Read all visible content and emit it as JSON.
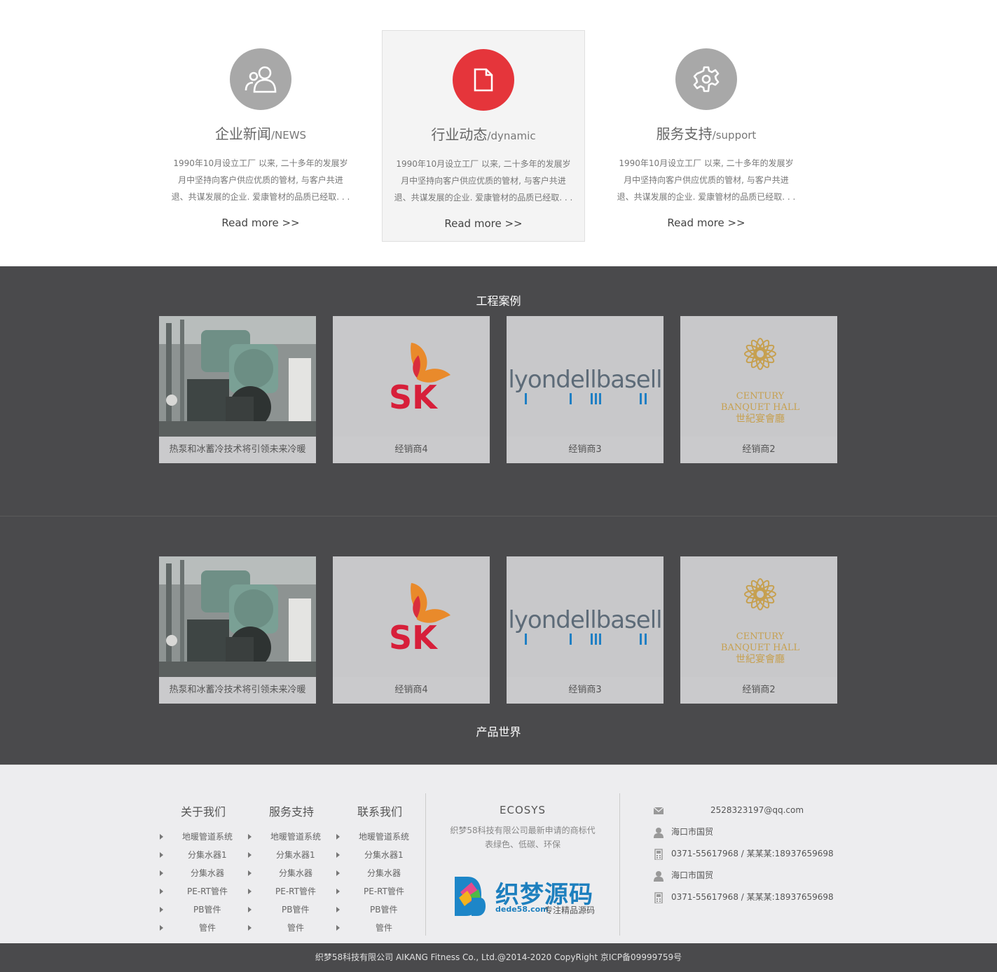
{
  "features": [
    {
      "title": "企业新闻",
      "sub": "/NEWS",
      "icon": "users-icon",
      "desc": "1990年10月设立工厂  以来, 二十多年的发展岁月中坚持向客户供应优质的管材, 与客户共进退、共谋发展的企业. 爱康管材的品质已经取. . .",
      "more": "Read more >>"
    },
    {
      "title": "行业动态",
      "sub": "/dynamic",
      "icon": "document-icon",
      "desc": "1990年10月设立工厂  以来, 二十多年的发展岁月中坚持向客户供应优质的管材, 与客户共进退、共谋发展的企业. 爱康管材的品质已经取. . .",
      "more": "Read more >>"
    },
    {
      "title": "服务支持",
      "sub": "/support",
      "icon": "gear-icon",
      "desc": "1990年10月设立工厂  以来, 二十多年的发展岁月中坚持向客户供应优质的管材, 与客户共进退、共谋发展的企业. 爱康管材的品质已经取. . .",
      "more": "Read more >>"
    }
  ],
  "cases": {
    "title": "工程案例",
    "items": [
      {
        "label": "热泵和冰蓄冷技术将引领未来冷暖"
      },
      {
        "label": "经销商4",
        "logo_text": "SK"
      },
      {
        "label": "经销商3",
        "logo_text": "lyondellbasell"
      },
      {
        "label": "经销商2",
        "logo_text": [
          "CENTURY",
          "BANQUET HALL",
          "世紀宴會廳"
        ]
      }
    ]
  },
  "products": {
    "title": "产品世界",
    "items": [
      {
        "label": "热泵和冰蓄冷技术将引领未来冷暖"
      },
      {
        "label": "经销商4",
        "logo_text": "SK"
      },
      {
        "label": "经销商3",
        "logo_text": "lyondellbasell"
      },
      {
        "label": "经销商2",
        "logo_text": [
          "CENTURY",
          "BANQUET HALL",
          "世紀宴會廳"
        ]
      }
    ]
  },
  "footer": {
    "columns": [
      {
        "head": "关于我们",
        "links": [
          "地暖管道系统",
          "分集水器1",
          "分集水器",
          "PE-RT管件",
          "PB管件",
          "管件"
        ]
      },
      {
        "head": "服务支持",
        "links": [
          "地暖管道系统",
          "分集水器1",
          "分集水器",
          "PE-RT管件",
          "PB管件",
          "管件"
        ]
      },
      {
        "head": "联系我们",
        "links": [
          "地暖管道系统",
          "分集水器1",
          "分集水器",
          "PE-RT管件",
          "PB管件",
          "管件"
        ]
      }
    ],
    "brand": {
      "head": "ECOSYS",
      "line1": "织梦58科技有限公司最新申请的商标代",
      "line2": "表绿色、低碳、环保",
      "logo_main": "织梦源码",
      "logo_domain": "dede58.com",
      "logo_tag": "专注精品源码"
    },
    "contact": [
      {
        "icon": "mail-icon",
        "text": "2528323197@qq.com"
      },
      {
        "icon": "person-icon",
        "text": "海口市国贸"
      },
      {
        "icon": "phone-icon",
        "text": "0371-55617968 / 某某某:18937659698"
      },
      {
        "icon": "person-icon",
        "text": "海口市国贸"
      },
      {
        "icon": "phone-icon",
        "text": "0371-55617968 / 某某某:18937659698"
      }
    ]
  },
  "copyright": "织梦58科技有限公司 AIKANG Fitness Co., Ltd.@2014-2020 CopyRight 京ICP备09999759号",
  "colors": {
    "accent": "#e5353b",
    "dark_band": "#4a4a4c",
    "footer_bg": "#ededef"
  }
}
